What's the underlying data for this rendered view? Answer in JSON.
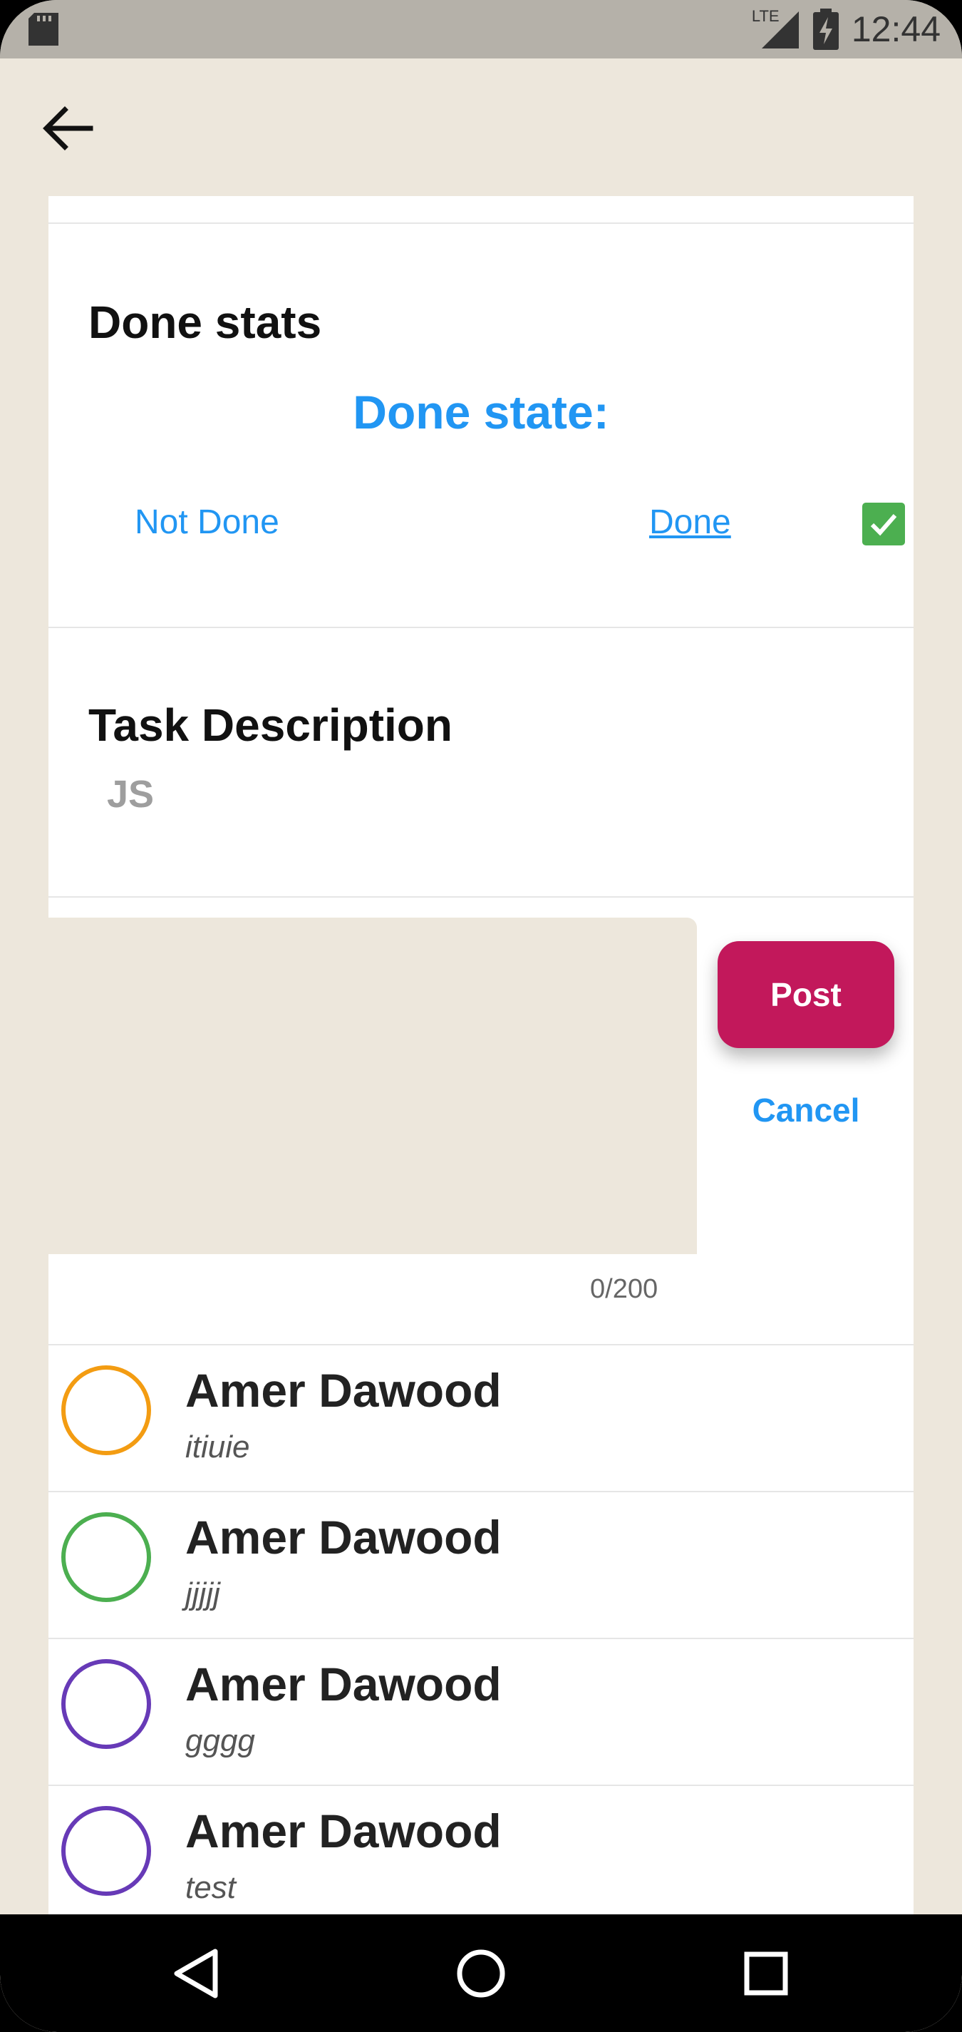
{
  "status_bar": {
    "network": "LTE",
    "time": "12:44",
    "left_icon": "sd-card-icon",
    "battery_icon": "battery-charging-icon",
    "signal_icon": "signal-icon"
  },
  "toolbar": {
    "back_icon": "arrow-left-icon"
  },
  "done_section": {
    "title": "Done stats",
    "state_label": "Done state:",
    "option_not_done": "Not Done",
    "option_done": "Done",
    "checkbox_checked": true,
    "accent_color": "#2196f3",
    "checkbox_color": "#4caf50"
  },
  "description_section": {
    "title": "Task Description",
    "value": "JS"
  },
  "comment_form": {
    "post_label": "Post",
    "cancel_label": "Cancel",
    "counter": "0/200",
    "post_color": "#c2185b"
  },
  "comments": [
    {
      "name": "Amer Dawood",
      "text": "itiuie",
      "avatar_color": "#f39c12"
    },
    {
      "name": "Amer Dawood",
      "text": "jjjjj",
      "avatar_color": "#4caf50"
    },
    {
      "name": "Amer Dawood",
      "text": "gggg",
      "avatar_color": "#673ab7"
    },
    {
      "name": "Amer Dawood",
      "text": "test",
      "avatar_color": "#673ab7"
    }
  ],
  "nav_bar": {
    "back_icon": "triangle-back-icon",
    "home_icon": "circle-home-icon",
    "recents_icon": "square-recents-icon"
  }
}
